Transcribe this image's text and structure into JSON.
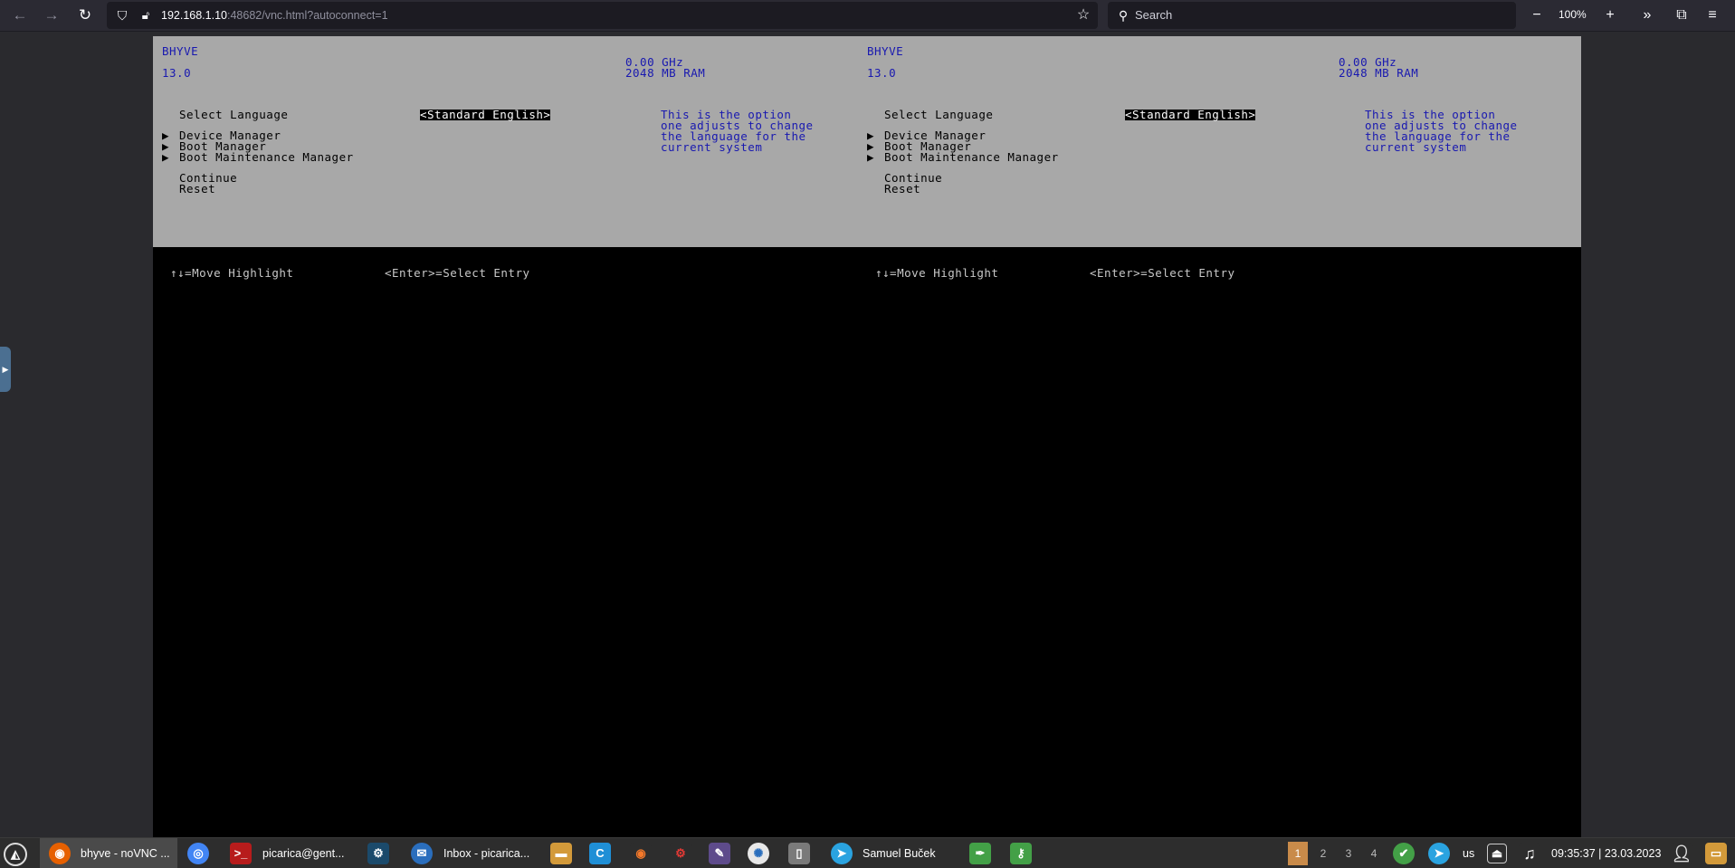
{
  "browser": {
    "url_host": "192.168.1.10",
    "url_rest": ":48682/vnc.html?autoconnect=1",
    "search_placeholder": "Search",
    "zoom": "100%"
  },
  "screens": [
    {
      "vendor": "BHYVE",
      "version": "13.0",
      "cpu": "0.00 GHz",
      "ram": "2048 MB RAM",
      "menu": {
        "select_language": "Select Language",
        "language_value": "<Standard English>",
        "device_manager": "Device Manager",
        "boot_manager": "Boot Manager",
        "boot_maintenance": "Boot Maintenance Manager",
        "continue": "Continue",
        "reset": "Reset"
      },
      "help_lines": [
        "This is the option",
        "one adjusts to change",
        "the language for the",
        "current system"
      ],
      "footer": {
        "move": "↑↓=Move Highlight",
        "select": "<Enter>=Select Entry"
      }
    },
    {
      "vendor": "BHYVE",
      "version": "13.0",
      "cpu": "0.00 GHz",
      "ram": "2048 MB RAM",
      "menu": {
        "select_language": "Select Language",
        "language_value": "<Standard English>",
        "device_manager": "Device Manager",
        "boot_manager": "Boot Manager",
        "boot_maintenance": "Boot Maintenance Manager",
        "continue": "Continue",
        "reset": "Reset"
      },
      "help_lines": [
        "This is the option",
        "one adjusts to change",
        "the language for the",
        "current system"
      ],
      "footer": {
        "move": "↑↓=Move Highlight",
        "select": "<Enter>=Select Entry"
      }
    }
  ],
  "taskbar": {
    "firefox_label": "bhyve - noVNC ...",
    "terminal_label": "picarica@gent...",
    "mail_label": "Inbox - picarica...",
    "telegram_label": "Samuel Buček",
    "workspaces": [
      "1",
      "2",
      "3",
      "4"
    ],
    "keyboard_layout": "us",
    "clock": "09:35:37 | 23.03.2023"
  },
  "colors": {
    "efi_panel": "#a8a8a8",
    "efi_blue": "#1818b0",
    "workspace_active": "#c98b4a"
  }
}
